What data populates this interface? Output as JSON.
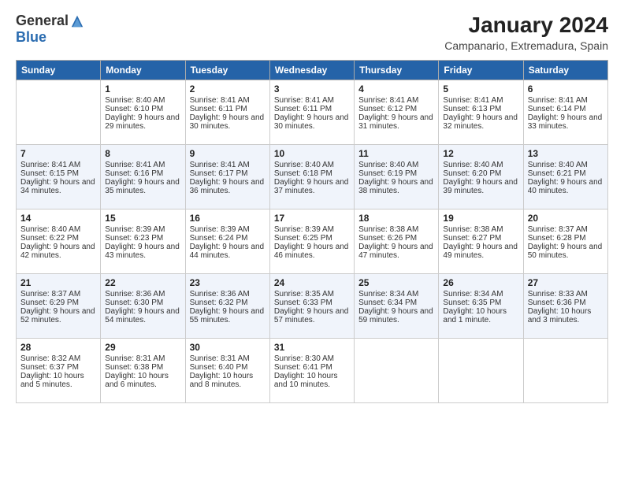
{
  "logo": {
    "general": "General",
    "blue": "Blue"
  },
  "header": {
    "title": "January 2024",
    "subtitle": "Campanario, Extremadura, Spain"
  },
  "weekdays": [
    "Sunday",
    "Monday",
    "Tuesday",
    "Wednesday",
    "Thursday",
    "Friday",
    "Saturday"
  ],
  "weeks": [
    [
      {
        "day": "",
        "sunrise": "",
        "sunset": "",
        "daylight": ""
      },
      {
        "day": "1",
        "sunrise": "Sunrise: 8:40 AM",
        "sunset": "Sunset: 6:10 PM",
        "daylight": "Daylight: 9 hours and 29 minutes."
      },
      {
        "day": "2",
        "sunrise": "Sunrise: 8:41 AM",
        "sunset": "Sunset: 6:11 PM",
        "daylight": "Daylight: 9 hours and 30 minutes."
      },
      {
        "day": "3",
        "sunrise": "Sunrise: 8:41 AM",
        "sunset": "Sunset: 6:11 PM",
        "daylight": "Daylight: 9 hours and 30 minutes."
      },
      {
        "day": "4",
        "sunrise": "Sunrise: 8:41 AM",
        "sunset": "Sunset: 6:12 PM",
        "daylight": "Daylight: 9 hours and 31 minutes."
      },
      {
        "day": "5",
        "sunrise": "Sunrise: 8:41 AM",
        "sunset": "Sunset: 6:13 PM",
        "daylight": "Daylight: 9 hours and 32 minutes."
      },
      {
        "day": "6",
        "sunrise": "Sunrise: 8:41 AM",
        "sunset": "Sunset: 6:14 PM",
        "daylight": "Daylight: 9 hours and 33 minutes."
      }
    ],
    [
      {
        "day": "7",
        "sunrise": "Sunrise: 8:41 AM",
        "sunset": "Sunset: 6:15 PM",
        "daylight": "Daylight: 9 hours and 34 minutes."
      },
      {
        "day": "8",
        "sunrise": "Sunrise: 8:41 AM",
        "sunset": "Sunset: 6:16 PM",
        "daylight": "Daylight: 9 hours and 35 minutes."
      },
      {
        "day": "9",
        "sunrise": "Sunrise: 8:41 AM",
        "sunset": "Sunset: 6:17 PM",
        "daylight": "Daylight: 9 hours and 36 minutes."
      },
      {
        "day": "10",
        "sunrise": "Sunrise: 8:40 AM",
        "sunset": "Sunset: 6:18 PM",
        "daylight": "Daylight: 9 hours and 37 minutes."
      },
      {
        "day": "11",
        "sunrise": "Sunrise: 8:40 AM",
        "sunset": "Sunset: 6:19 PM",
        "daylight": "Daylight: 9 hours and 38 minutes."
      },
      {
        "day": "12",
        "sunrise": "Sunrise: 8:40 AM",
        "sunset": "Sunset: 6:20 PM",
        "daylight": "Daylight: 9 hours and 39 minutes."
      },
      {
        "day": "13",
        "sunrise": "Sunrise: 8:40 AM",
        "sunset": "Sunset: 6:21 PM",
        "daylight": "Daylight: 9 hours and 40 minutes."
      }
    ],
    [
      {
        "day": "14",
        "sunrise": "Sunrise: 8:40 AM",
        "sunset": "Sunset: 6:22 PM",
        "daylight": "Daylight: 9 hours and 42 minutes."
      },
      {
        "day": "15",
        "sunrise": "Sunrise: 8:39 AM",
        "sunset": "Sunset: 6:23 PM",
        "daylight": "Daylight: 9 hours and 43 minutes."
      },
      {
        "day": "16",
        "sunrise": "Sunrise: 8:39 AM",
        "sunset": "Sunset: 6:24 PM",
        "daylight": "Daylight: 9 hours and 44 minutes."
      },
      {
        "day": "17",
        "sunrise": "Sunrise: 8:39 AM",
        "sunset": "Sunset: 6:25 PM",
        "daylight": "Daylight: 9 hours and 46 minutes."
      },
      {
        "day": "18",
        "sunrise": "Sunrise: 8:38 AM",
        "sunset": "Sunset: 6:26 PM",
        "daylight": "Daylight: 9 hours and 47 minutes."
      },
      {
        "day": "19",
        "sunrise": "Sunrise: 8:38 AM",
        "sunset": "Sunset: 6:27 PM",
        "daylight": "Daylight: 9 hours and 49 minutes."
      },
      {
        "day": "20",
        "sunrise": "Sunrise: 8:37 AM",
        "sunset": "Sunset: 6:28 PM",
        "daylight": "Daylight: 9 hours and 50 minutes."
      }
    ],
    [
      {
        "day": "21",
        "sunrise": "Sunrise: 8:37 AM",
        "sunset": "Sunset: 6:29 PM",
        "daylight": "Daylight: 9 hours and 52 minutes."
      },
      {
        "day": "22",
        "sunrise": "Sunrise: 8:36 AM",
        "sunset": "Sunset: 6:30 PM",
        "daylight": "Daylight: 9 hours and 54 minutes."
      },
      {
        "day": "23",
        "sunrise": "Sunrise: 8:36 AM",
        "sunset": "Sunset: 6:32 PM",
        "daylight": "Daylight: 9 hours and 55 minutes."
      },
      {
        "day": "24",
        "sunrise": "Sunrise: 8:35 AM",
        "sunset": "Sunset: 6:33 PM",
        "daylight": "Daylight: 9 hours and 57 minutes."
      },
      {
        "day": "25",
        "sunrise": "Sunrise: 8:34 AM",
        "sunset": "Sunset: 6:34 PM",
        "daylight": "Daylight: 9 hours and 59 minutes."
      },
      {
        "day": "26",
        "sunrise": "Sunrise: 8:34 AM",
        "sunset": "Sunset: 6:35 PM",
        "daylight": "Daylight: 10 hours and 1 minute."
      },
      {
        "day": "27",
        "sunrise": "Sunrise: 8:33 AM",
        "sunset": "Sunset: 6:36 PM",
        "daylight": "Daylight: 10 hours and 3 minutes."
      }
    ],
    [
      {
        "day": "28",
        "sunrise": "Sunrise: 8:32 AM",
        "sunset": "Sunset: 6:37 PM",
        "daylight": "Daylight: 10 hours and 5 minutes."
      },
      {
        "day": "29",
        "sunrise": "Sunrise: 8:31 AM",
        "sunset": "Sunset: 6:38 PM",
        "daylight": "Daylight: 10 hours and 6 minutes."
      },
      {
        "day": "30",
        "sunrise": "Sunrise: 8:31 AM",
        "sunset": "Sunset: 6:40 PM",
        "daylight": "Daylight: 10 hours and 8 minutes."
      },
      {
        "day": "31",
        "sunrise": "Sunrise: 8:30 AM",
        "sunset": "Sunset: 6:41 PM",
        "daylight": "Daylight: 10 hours and 10 minutes."
      },
      {
        "day": "",
        "sunrise": "",
        "sunset": "",
        "daylight": ""
      },
      {
        "day": "",
        "sunrise": "",
        "sunset": "",
        "daylight": ""
      },
      {
        "day": "",
        "sunrise": "",
        "sunset": "",
        "daylight": ""
      }
    ]
  ]
}
